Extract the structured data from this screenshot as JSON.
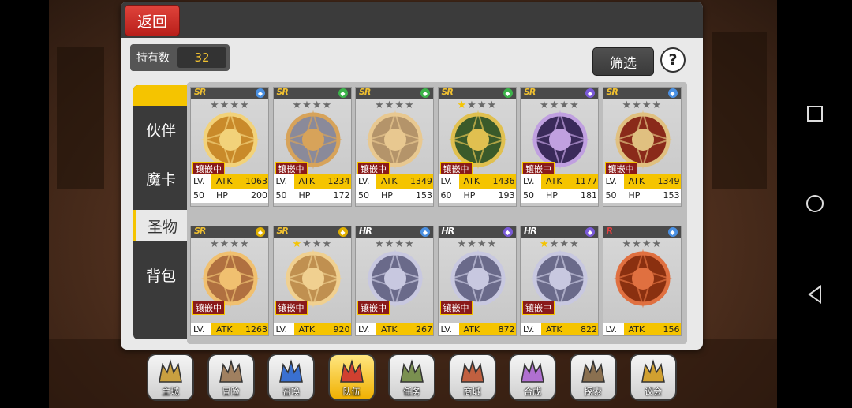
{
  "header": {
    "back_label": "返回"
  },
  "owned": {
    "label": "持有数",
    "value": "32"
  },
  "filter_label": "筛选",
  "help_label": "?",
  "sidebar": {
    "tabs": [
      "伙伴",
      "魔卡",
      "圣物",
      "背包"
    ],
    "active": "圣物"
  },
  "embed_label": "镶嵌中",
  "stat_labels": {
    "lv": "LV.",
    "atk": "ATK",
    "hp": "HP"
  },
  "relics_row1": [
    {
      "rarity": "SR",
      "stars_lit": 0,
      "embedded": true,
      "lv": "50",
      "atk": "1063",
      "hp": "200",
      "element_color": "#4a90e2"
    },
    {
      "rarity": "SR",
      "stars_lit": 0,
      "embedded": true,
      "lv": "50",
      "atk": "1234",
      "hp": "172",
      "element_color": "#3cb34a"
    },
    {
      "rarity": "SR",
      "stars_lit": 0,
      "embedded": true,
      "lv": "50",
      "atk": "1349",
      "hp": "153",
      "element_color": "#3cb34a"
    },
    {
      "rarity": "SR",
      "stars_lit": 1,
      "embedded": true,
      "lv": "60",
      "atk": "1436",
      "hp": "193",
      "element_color": "#3cb34a"
    },
    {
      "rarity": "SR",
      "stars_lit": 0,
      "embedded": true,
      "lv": "50",
      "atk": "1177",
      "hp": "181",
      "element_color": "#7a5ad8"
    },
    {
      "rarity": "SR",
      "stars_lit": 0,
      "embedded": true,
      "lv": "50",
      "atk": "1349",
      "hp": "153",
      "element_color": "#4a90e2"
    }
  ],
  "relics_row2": [
    {
      "rarity": "SR",
      "stars_lit": 0,
      "embedded": true,
      "atk": "1263",
      "element_color": "#e0b000"
    },
    {
      "rarity": "SR",
      "stars_lit": 1,
      "embedded": true,
      "atk": "920",
      "element_color": "#e0b000"
    },
    {
      "rarity": "HR",
      "stars_lit": 0,
      "embedded": true,
      "atk": "267",
      "element_color": "#4a90e2"
    },
    {
      "rarity": "HR",
      "stars_lit": 0,
      "embedded": true,
      "atk": "872",
      "element_color": "#7a5ad8"
    },
    {
      "rarity": "HR",
      "stars_lit": 1,
      "embedded": true,
      "atk": "822",
      "element_color": "#7a5ad8"
    },
    {
      "rarity": "R",
      "stars_lit": 0,
      "embedded": false,
      "atk": "156",
      "element_color": "#4a90e2"
    }
  ],
  "bottom_nav": [
    {
      "label": "主城",
      "icon": "castle-icon"
    },
    {
      "label": "冒险",
      "icon": "axe-icon"
    },
    {
      "label": "召唤",
      "icon": "cards-icon"
    },
    {
      "label": "队伍",
      "icon": "wings-emblem-icon",
      "active": true
    },
    {
      "label": "任务",
      "icon": "scroll-icon"
    },
    {
      "label": "商城",
      "icon": "mushroom-shop-icon"
    },
    {
      "label": "合成",
      "icon": "flask-icon"
    },
    {
      "label": "探索",
      "icon": "crossbow-icon"
    },
    {
      "label": "议会",
      "icon": "crown-icon"
    }
  ]
}
